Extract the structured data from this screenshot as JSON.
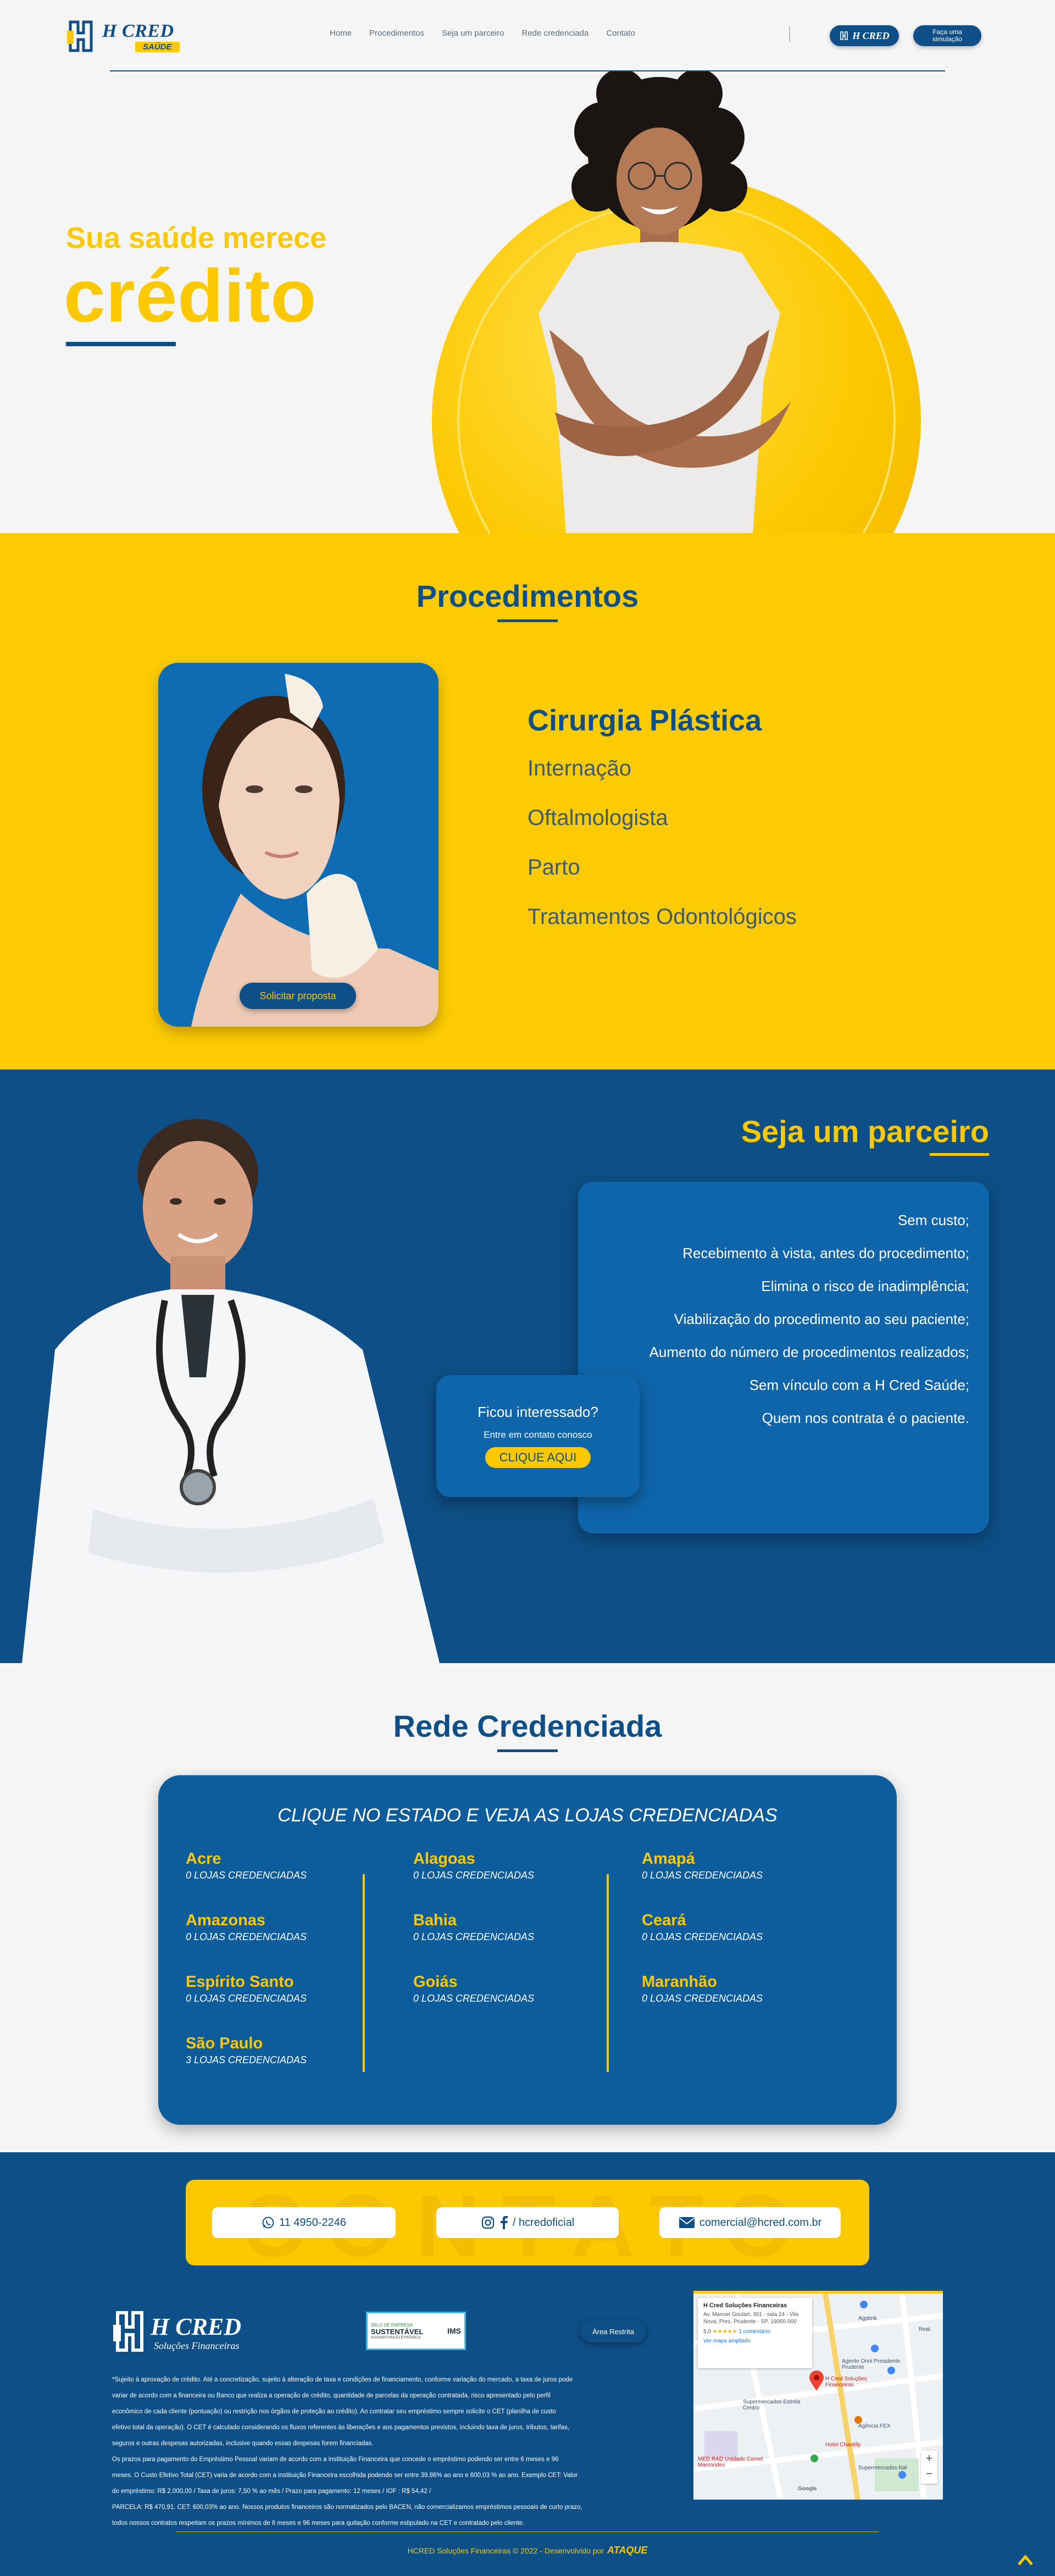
{
  "header": {
    "logo_name": "H CRED",
    "logo_tag": "SAÚDE",
    "nav": [
      "Home",
      "Procedimentos",
      "Seja um parceiro",
      "Rede credenciada",
      "Contato"
    ],
    "login_label": "H CRED",
    "simulate_label": "Faça uma simulação"
  },
  "hero": {
    "subtitle": "Sua saúde merece",
    "title": "crédito"
  },
  "procedimentos": {
    "title": "Procedimentos",
    "button": "Solicitar proposta",
    "main": "Cirurgia Plástica",
    "items": [
      "Internação",
      "Oftalmologista",
      "Parto",
      "Tratamentos Odontológicos"
    ]
  },
  "parceiro": {
    "title": "Seja um parceiro",
    "benefits": [
      "Sem custo;",
      "Recebimento à vista, antes do procedimento;",
      "Elimina o risco de inadimplência;",
      "Viabilização do procedimento ao seu paciente;",
      "Aumento do número de procedimentos realizados;",
      "Sem vínculo com a H Cred Saúde;",
      "Quem nos contrata é o paciente."
    ],
    "interest_q": "Ficou interessado?",
    "interest_s": "Entre em contato conosco",
    "interest_btn": "CLIQUE AQUI"
  },
  "rede": {
    "title": "Rede Credenciada",
    "cta": "CLIQUE NO ESTADO E VEJA AS LOJAS CREDENCIADAS",
    "col1": [
      {
        "name": "Acre",
        "count": "0 LOJAS CREDENCIADAS"
      },
      {
        "name": "Amazonas",
        "count": "0 LOJAS CREDENCIADAS"
      },
      {
        "name": "Espírito Santo",
        "count": "0 LOJAS CREDENCIADAS"
      },
      {
        "name": "São Paulo",
        "count": "3 LOJAS CREDENCIADAS"
      }
    ],
    "col2": [
      {
        "name": "Alagoas",
        "count": "0 LOJAS CREDENCIADAS"
      },
      {
        "name": "Bahia",
        "count": "0 LOJAS CREDENCIADAS"
      },
      {
        "name": "Goiás",
        "count": "0 LOJAS CREDENCIADAS"
      }
    ],
    "col3": [
      {
        "name": "Amapá",
        "count": "0 LOJAS CREDENCIADAS"
      },
      {
        "name": "Ceará",
        "count": "0 LOJAS CREDENCIADAS"
      },
      {
        "name": "Maranhão",
        "count": "0 LOJAS CREDENCIADAS"
      }
    ]
  },
  "contato": {
    "bg_word": "CONTATO",
    "phone": "11 4950-2246",
    "social": "/ hcredoficial",
    "email": "comercial@hcred.com.br"
  },
  "footer": {
    "logo_name": "H CRED",
    "logo_tag": "Soluções Financeiras",
    "badge_t1": "SELO DE EMPRESA",
    "badge_t2": "SUSTENTÁVEL",
    "badge_t3": "ASSINATURA ELETRÔNICA",
    "badge_mark": "IMS",
    "area_btn": "Área Restrita",
    "legal": [
      "*Sujeito à aprovação de crédito. Até a concretização, sujeito à alteração de taxa e condições de financiamento, conforme variação do mercado, a taxa de juros pode",
      "variar de acordo com a financeira ou Banco que realiza a operação de crédito, quantidade de parcelas da operação contratada, risco apresentado pelo perfil",
      "econômico de cada cliente (pontuação) ou restrição nos órgãos de proteção ao crédito). Ao contratar seu empréstimo sempre solicite o CET (planilha de custo",
      "efetivo total da operação). O CET é calculado considerando os fluxos referentes às liberações e aos pagamentos previstos, incluindo taxa de juros, tributos, tarifas,",
      "seguros e outras despesas autorizadas, inclusive quando essas despesas forem financiadas.",
      "Os prazos para pagamento do Empréstimo Pessoal variam de acordo com a instituição Financeira que concede o empréstimo podendo ser entre 6 meses e 96",
      "meses. O Custo Efetivo Total (CET) varia de acordo com a instituição Financeira escolhida podendo ser entre 39,86% ao ano e 600,03 % ao ano. Exemplo CET: Valor",
      "do empréstimo: R$ 2.000,00 / Taxa de juros: 7,50 % ao mês / Prazo para pagamento: 12 meses / IOF : R$ 54,42 /",
      "PARCELA: R$ 470,91. CET: 600,03% ao ano. Nossos produtos financeiros são normatizados pelo BACEN, não comercializamos empréstimos pessoais de curto prazo,",
      "todos nossos contratos respeitam os prazos mínimos de 6 meses e 96 meses para quitação conforme estipulado na CET e contratado pelo cliente."
    ],
    "map": {
      "title": "H Cred Soluções Financeiras",
      "address": "Av. Manoel Goulart, 301 - sala 24 - Vila Nova, Pres. Prudente - SP, 19060-000",
      "rating": "5,0",
      "stars": "★★★★★",
      "reviews": "1 comentário",
      "link": "Ver mapa ampliado",
      "pin_label": "H Cred Soluções Financeiras",
      "labels": [
        "Agpbnk",
        "Real",
        "Agente Onni Presidente Prudente",
        "Agência FEX",
        "Supermercados Estrela Centro",
        "Hotel Chantilly",
        "MED RAD Unidade Cornel Marcondes",
        "Supermercados Nal",
        "Google"
      ]
    },
    "copyright": "HCRED Soluções Financeiras © 2022 - Desenvolvido por",
    "developer": "ATAQUE"
  }
}
